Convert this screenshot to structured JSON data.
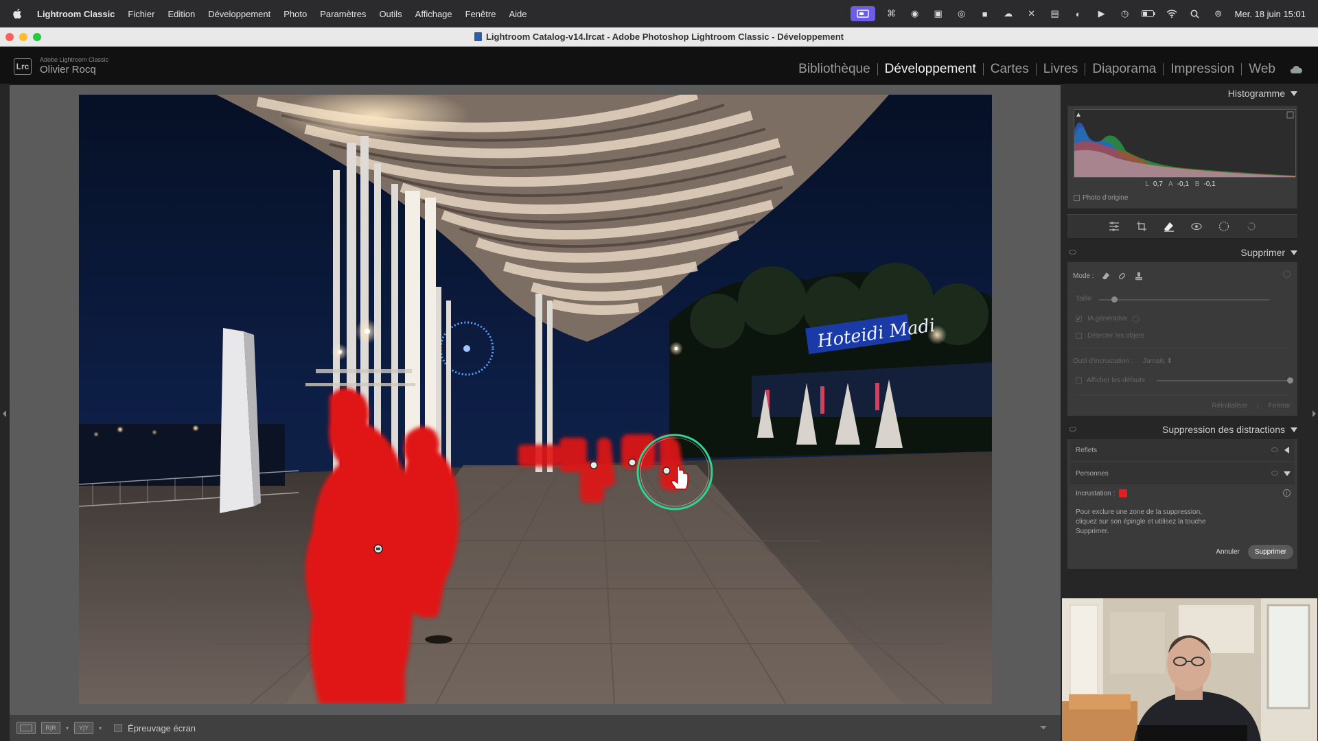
{
  "menubar": {
    "app": "Lightroom Classic",
    "items": [
      "Fichier",
      "Edition",
      "Développement",
      "Photo",
      "Paramètres",
      "Outils",
      "Affichage",
      "Fenêtre",
      "Aide"
    ],
    "clock": "Mer. 18 juin  15:01"
  },
  "window": {
    "title": "Lightroom Catalog-v14.lrcat - Adobe Photoshop Lightroom Classic - Développement"
  },
  "identity": {
    "logo": "Lrc",
    "product": "Adobe Lightroom Classic",
    "user": "Olivier Rocq"
  },
  "modules": {
    "items": [
      "Bibliothèque",
      "Développement",
      "Cartes",
      "Livres",
      "Diaporama",
      "Impression",
      "Web"
    ],
    "active": "Développement"
  },
  "histogram": {
    "title": "Histogramme",
    "l_label": "L",
    "l_value": "0,7",
    "a_label": "A",
    "a_value": "-0,1",
    "b_label": "B",
    "b_value": "-0,1",
    "photo_origine": "Photo d'origine"
  },
  "supprimer": {
    "title": "Supprimer",
    "mode_label": "Mode :",
    "taille_label": "Taille",
    "ia_generative": "IA générative",
    "detecter_objets": "Détecter les objets",
    "outil_incrustation": "Outil d'incrustation :",
    "outil_value": "Jamais",
    "afficher_defauts": "Afficher les défauts",
    "reinitialiser": "Réinitialiser",
    "fermer": "Fermer"
  },
  "distractions": {
    "title": "Suppression des distractions",
    "reflets": "Reflets",
    "personnes": "Personnes",
    "incrustation": "Incrustation :",
    "help": "Pour exclure une zone de la suppression, cliquez sur son épingle et utilisez la touche Supprimer.",
    "annuler": "Annuler",
    "supprimer": "Supprimer"
  },
  "toolbar": {
    "epreuvage": "Épreuvage écran"
  },
  "colors": {
    "mask": "#e01818",
    "brush_ring": "#2fd68f",
    "accent_active": "#6c5ce7"
  }
}
